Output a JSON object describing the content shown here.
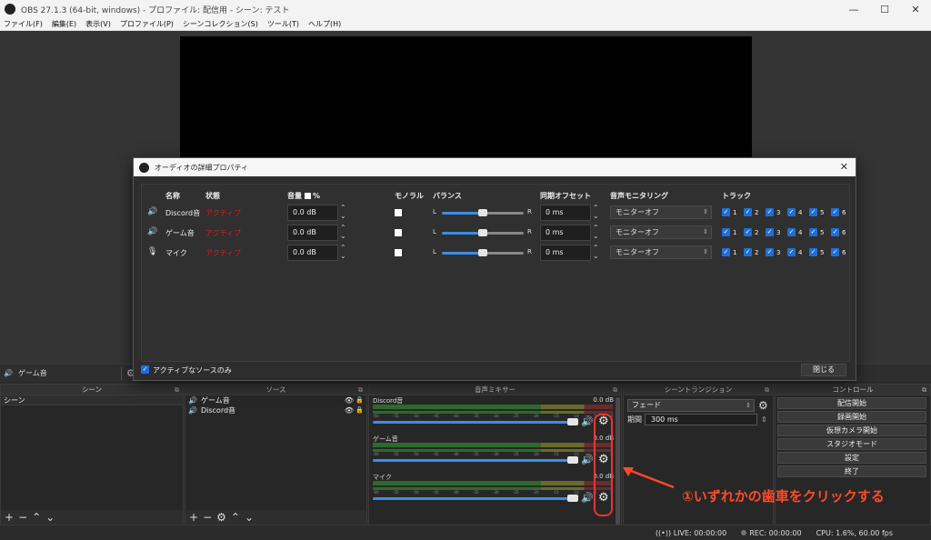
{
  "window": {
    "title": "OBS 27.1.3 (64-bit, windows) - プロファイル: 配信用 - シーン: テスト",
    "min": "—",
    "max": "☐",
    "close": "✕"
  },
  "menu": [
    "ファイル(F)",
    "編集(E)",
    "表示(V)",
    "プロファイル(P)",
    "シーンコレクション(S)",
    "ツール(T)",
    "ヘルプ(H)"
  ],
  "source_bar": {
    "label": "ゲーム音"
  },
  "dialog": {
    "title": "オーディオの詳細プロパティ",
    "headers": {
      "name": "名称",
      "status": "状態",
      "volume": "音量",
      "percent": "%",
      "mono": "モノラル",
      "balance": "バランス",
      "sync_offset": "同期オフセット",
      "monitoring": "音声モニタリング",
      "tracks": "トラック"
    },
    "rows": [
      {
        "name": "Discord音",
        "status": "アクティブ",
        "volume": "0.0 dB",
        "balance_l": "L",
        "balance_r": "R",
        "offset": "0 ms",
        "monitoring": "モニターオフ",
        "icon": "speaker-icon"
      },
      {
        "name": "ゲーム音",
        "status": "アクティブ",
        "volume": "0.0 dB",
        "balance_l": "L",
        "balance_r": "R",
        "offset": "0 ms",
        "monitoring": "モニターオフ",
        "icon": "speaker-icon"
      },
      {
        "name": "マイク",
        "status": "アクティブ",
        "volume": "0.0 dB",
        "balance_l": "L",
        "balance_r": "R",
        "offset": "0 ms",
        "monitoring": "モニターオフ",
        "icon": "microphone-icon"
      }
    ],
    "track_labels": [
      "1",
      "2",
      "3",
      "4",
      "5",
      "6"
    ],
    "active_only_label": "アクティブなソースのみ",
    "close_label": "閉じる"
  },
  "docks": {
    "scenes": {
      "title": "シーン",
      "items": [
        "シーン"
      ]
    },
    "sources": {
      "title": "ソース",
      "items": [
        "ゲーム音",
        "Discord音"
      ]
    },
    "mixer": {
      "title": "音声ミキサー",
      "channels": [
        {
          "name": "Discord音",
          "db": "0.0 dB"
        },
        {
          "name": "ゲーム音",
          "db": "0.0 dB"
        },
        {
          "name": "マイク",
          "db": "0.0 dB"
        }
      ],
      "ticks": [
        "-60",
        "-55",
        "-50",
        "-45",
        "-40",
        "-35",
        "-30",
        "-25",
        "-20",
        "-15",
        "-10",
        "-5",
        "0"
      ]
    },
    "transitions": {
      "title": "シーントランジション",
      "type": "フェード",
      "duration_label": "期間",
      "duration_value": "300 ms"
    },
    "controls": {
      "title": "コントロール",
      "buttons": [
        "配信開始",
        "録画開始",
        "仮想カメラ開始",
        "スタジオモード",
        "設定",
        "終了"
      ]
    }
  },
  "annotation": "①いずれかの歯車をクリックする",
  "status": {
    "live": "LIVE: 00:00:00",
    "rec": "REC: 00:00:00",
    "cpu": "CPU: 1.6%, 60.00 fps"
  },
  "colors": {
    "accent": "#3a8ee6",
    "annotation": "#ff4a2a",
    "status_red": "#cc2222"
  }
}
